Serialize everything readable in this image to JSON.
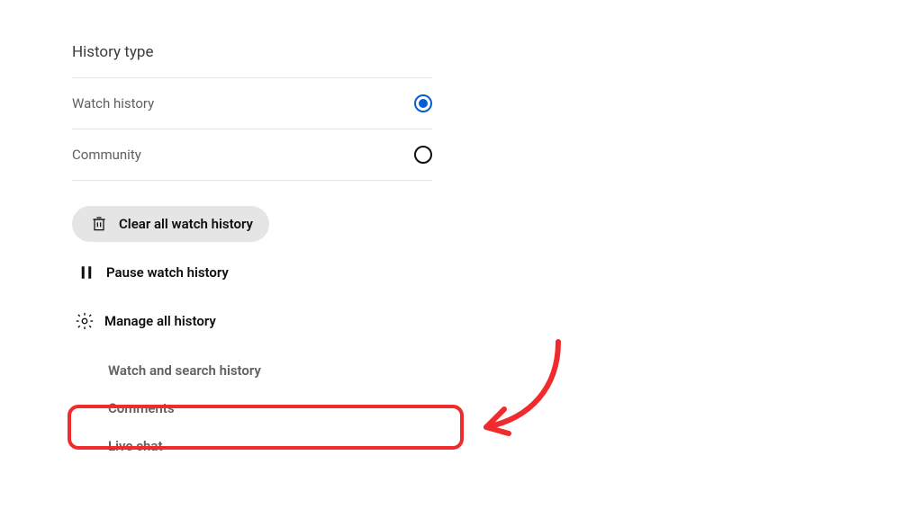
{
  "panel": {
    "title": "History type",
    "options": {
      "watch_history": "Watch history",
      "community": "Community"
    },
    "actions": {
      "clear_all": "Clear all watch history",
      "pause": "Pause watch history",
      "manage": "Manage all history"
    },
    "sublinks": {
      "watch_search": "Watch and search history",
      "comments": "Comments",
      "live_chat": "Live chat"
    }
  },
  "annotation_color": "#ef2b2d"
}
